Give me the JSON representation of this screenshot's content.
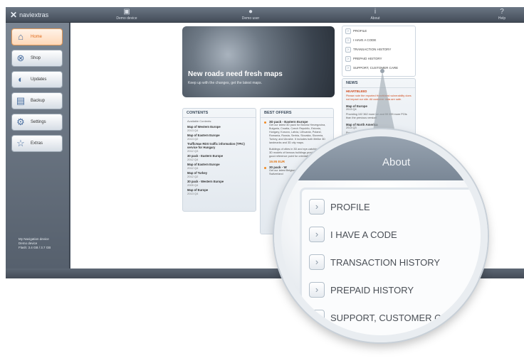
{
  "app": {
    "logo_text": "naviextras"
  },
  "topnav": [
    {
      "label": "Demo device",
      "icon": "device-icon"
    },
    {
      "label": "Demo user",
      "icon": "user-icon"
    },
    {
      "label": "About",
      "icon": "info-icon"
    },
    {
      "label": "Help",
      "icon": "help-icon"
    }
  ],
  "sidebar": {
    "items": [
      {
        "label": "Home",
        "icon": "home-icon",
        "active": true
      },
      {
        "label": "Shop",
        "icon": "shop-icon",
        "active": false
      },
      {
        "label": "Updates",
        "icon": "updates-icon",
        "active": false
      },
      {
        "label": "Backup",
        "icon": "backup-icon",
        "active": false
      },
      {
        "label": "Settings",
        "icon": "settings-icon",
        "active": false
      },
      {
        "label": "Extras",
        "icon": "extras-icon",
        "active": false
      }
    ],
    "device_info": [
      "My Navigation device",
      "Demo device",
      "Flash: 3.4 GB / 3.7 GB"
    ]
  },
  "hero": {
    "title": "New roads need fresh maps",
    "subtitle": "Keep up with the changes, get the latest maps."
  },
  "contents": {
    "title": "CONTENTS",
    "available_label": "Available Contents:",
    "items": [
      {
        "name": "Map of Western Europe",
        "ver": "2013 Q4"
      },
      {
        "name": "Map of Eastern Europe",
        "ver": "2013 Q2"
      },
      {
        "name": "TrafficNav RDS traffic information (TPIC) service for Hungary",
        "ver": "2012 Q3"
      },
      {
        "name": "30 pack - Eastern Europe",
        "ver": "2012 Q4"
      },
      {
        "name": "Map of Eastern Europe",
        "ver": "2012 Q4"
      },
      {
        "name": "Map of Turkey",
        "ver": "2012 Q2"
      },
      {
        "name": "30 pack - Western Europe",
        "ver": "2009 Q4"
      },
      {
        "name": "Map of Europe",
        "ver": "2013 Q4"
      }
    ]
  },
  "offers": {
    "title": "BEST OFFERS",
    "items": [
      {
        "title": "3D pack - Eastern Europe",
        "desc": "Get our latest 3D pack for Bosnia Herzegovina, Bulgaria, Croatia, Czech Republic, Estonia, Hungary, Kosovo, Latvia, Lithuania, Poland, Romania, Russia, Serbia, Slovakia, Slovenia, Turkey, and Ukraine. It includes both lifelike 3D landmarks and 3D city maps."
      },
      {
        "title": "",
        "desc": "Buildings of cities in 3D and eye-catching models: 3D models of famous buildings provide you a good reference point for orientation while driving."
      }
    ],
    "price": "19.95 EUR",
    "second_title": "30 pack - W",
    "second_desc": "Get our latest Belgium, Fr Luxembourg, Switzerland"
  },
  "right_menu": {
    "items": [
      "PROFILE",
      "I HAVE A CODE",
      "TRANSACTION HISTORY",
      "PREPAID HISTORY",
      "SUPPORT, CUSTOMER CARE"
    ]
  },
  "news": {
    "title": "NEWS",
    "alert_title": "HEARTBLEED",
    "alert_text": "Please note the reported Heartbleed vulnerability does not impact our site. All customer data are safe.",
    "items": [
      {
        "title": "Map of Europe",
        "ver": "2013 Q4",
        "text": "Providing 102 362 more km and 59 099 more POIs than the previous version!"
      },
      {
        "title": "Map of North America",
        "ver": "2013 Q3",
        "text": "Providing 21 267 more km than the"
      }
    ]
  },
  "magnifier": {
    "header": "About",
    "items": [
      "PROFILE",
      "I HAVE A CODE",
      "TRANSACTION HISTORY",
      "PREPAID HISTORY",
      "SUPPORT, CUSTOMER CARE"
    ]
  }
}
